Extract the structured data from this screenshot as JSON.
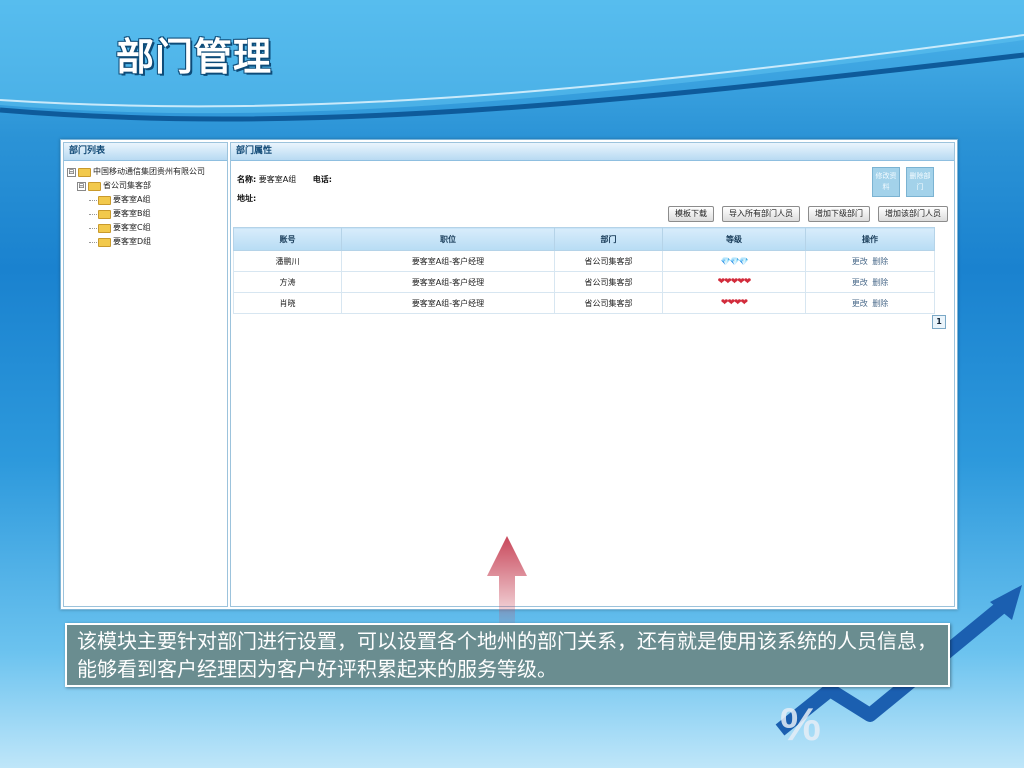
{
  "slide": {
    "title": "部门管理",
    "caption": "该模块主要针对部门进行设置，可以设置各个地州的部门关系，还有就是使用该系统的人员信息，能够看到客户经理因为客户好评积累起来的服务等级。"
  },
  "left_panel": {
    "title": "部门列表",
    "tree": [
      {
        "label": "中国移动通信集团贵州有限公司",
        "toggle": "⊟"
      },
      {
        "label": "省公司集客部",
        "toggle": "⊟"
      },
      {
        "label": "要客室A组"
      },
      {
        "label": "要客室B组"
      },
      {
        "label": "要客室C组"
      },
      {
        "label": "要客室D组"
      }
    ]
  },
  "right_panel": {
    "title": "部门属性",
    "name_label": "名称:",
    "name_value": "要客室A组",
    "phone_label": "电话:",
    "phone_value": "",
    "address_label": "地址:",
    "side_buttons": [
      "修改资料",
      "删除部门"
    ],
    "buttons": {
      "template_download": "模板下载",
      "import_members": "导入所有部门人员",
      "add_sub_dept": "增加下级部门",
      "add_member": "增加该部门人员"
    },
    "table": {
      "headers": [
        "账号",
        "职位",
        "部门",
        "等级",
        "操作"
      ],
      "rows": [
        {
          "account": "潘鹏川",
          "position": "要客室A组-客户经理",
          "department": "省公司集客部",
          "level": "💎💎💎",
          "edit": "更改",
          "delete": "删除"
        },
        {
          "account": "方涛",
          "position": "要客室A组-客户经理",
          "department": "省公司集客部",
          "level": "❤❤❤❤❤",
          "edit": "更改",
          "delete": "删除"
        },
        {
          "account": "肖晓",
          "position": "要客室A组-客户经理",
          "department": "省公司集客部",
          "level": "❤❤❤❤",
          "edit": "更改",
          "delete": "删除"
        }
      ]
    },
    "page": "1"
  }
}
